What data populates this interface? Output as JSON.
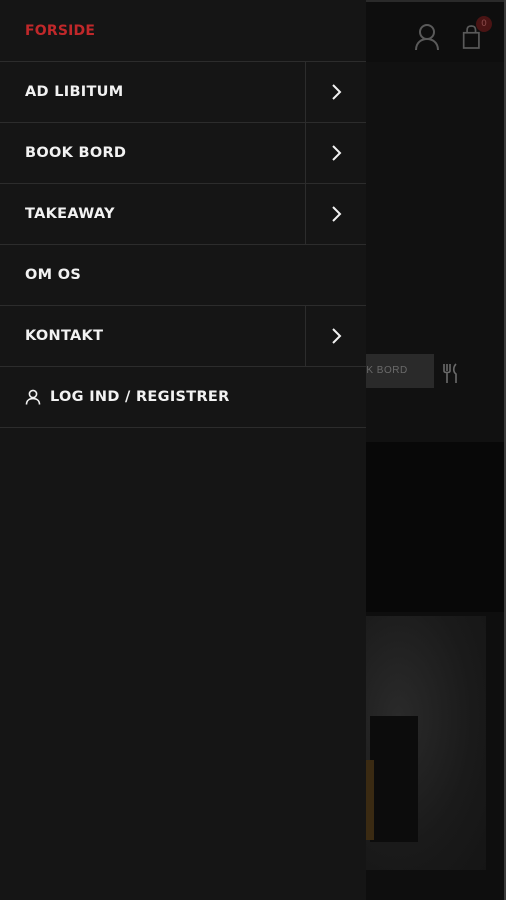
{
  "drawer": {
    "home_label": "FORSIDE",
    "items": [
      {
        "label": "AD LIBITUM",
        "has_submenu": true
      },
      {
        "label": "BOOK BORD",
        "has_submenu": true
      },
      {
        "label": "TAKEAWAY",
        "has_submenu": true
      },
      {
        "label": "OM OS",
        "has_submenu": false
      },
      {
        "label": "KONTAKT",
        "has_submenu": true
      }
    ],
    "login_label": "LOG IND / REGISTRER",
    "login_icon": "user-icon",
    "submenu_icon": "chevron-right-icon"
  },
  "background": {
    "cart_count": "0",
    "book_button_label": "K BORD",
    "header_icons": [
      "user-icon",
      "shopping-bag-icon"
    ],
    "book_icon": "cutlery-icon"
  },
  "colors": {
    "accent": "#c0282a",
    "drawer_bg": "#151515",
    "divider": "#2c2c2c",
    "text": "#f2f2f2"
  }
}
